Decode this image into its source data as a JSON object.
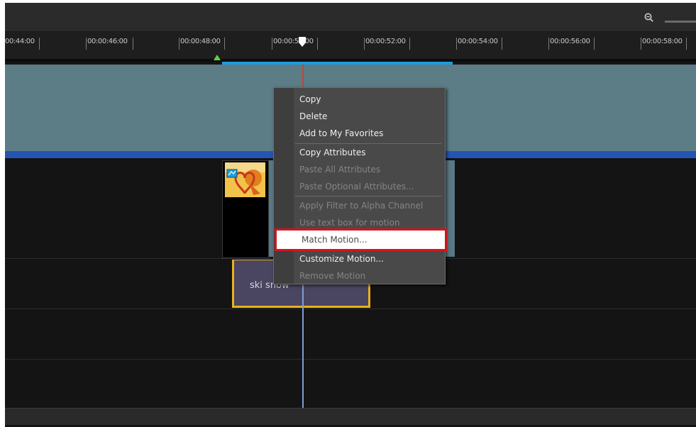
{
  "timeline": {
    "ruler_ticks": [
      "00:44:00",
      "00:00:46:00",
      "00:00:48:00",
      "00:00:50:00",
      "00:00:52:00",
      "00:00:54:00",
      "00:00:56:00",
      "00:00:58:00"
    ],
    "title_clip_label": "ski snow"
  },
  "toolbar": {
    "zoom_out_icon": "zoom-out-icon"
  },
  "context_menu": {
    "items": [
      {
        "label": "Copy",
        "enabled": true
      },
      {
        "label": "Delete",
        "enabled": true
      },
      {
        "label": "Add to My Favorites",
        "enabled": true
      },
      {
        "label": "Copy Attributes",
        "enabled": true
      },
      {
        "label": "Paste All Attributes",
        "enabled": false
      },
      {
        "label": "Paste Optional Attributes...",
        "enabled": false
      },
      {
        "label": "Apply Filter to Alpha Channel",
        "enabled": false
      },
      {
        "label": "Use text box for motion",
        "enabled": false
      },
      {
        "label": "Match Motion...",
        "enabled": true,
        "highlighted": true
      },
      {
        "label": "Customize Motion...",
        "enabled": true
      },
      {
        "label": "Remove Motion",
        "enabled": false
      }
    ]
  },
  "colors": {
    "highlight_border": "#d4141b",
    "range_bar": "#1e9be0",
    "video_track": "#5c7c86",
    "title_clip_border": "#e8b21d"
  }
}
